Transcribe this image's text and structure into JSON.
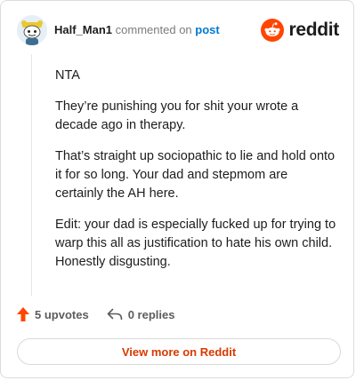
{
  "comment": {
    "username": "Half_Man1",
    "action_text": "commented on",
    "post_link": "post",
    "brand": "reddit",
    "paragraphs": [
      "NTA",
      "They’re punishing you for shit your wrote a decade ago in therapy.",
      "That’s straight up sociopathic to lie and hold onto it for so long. Your dad and stepmom are certainly the AH here.",
      "Edit: your dad is especially fucked up for trying to warp this all as justification to hate his own child. Honestly disgusting."
    ]
  },
  "actions": {
    "upvotes": "5 upvotes",
    "replies": "0 replies"
  },
  "footer": {
    "view_more": "View more on Reddit"
  },
  "colors": {
    "accent": "#ff4500",
    "link": "#0079d3",
    "view_more": "#d93a00"
  },
  "icons": [
    "avatar-snoo",
    "reddit-logo",
    "upvote-arrow-icon",
    "reply-icon"
  ]
}
